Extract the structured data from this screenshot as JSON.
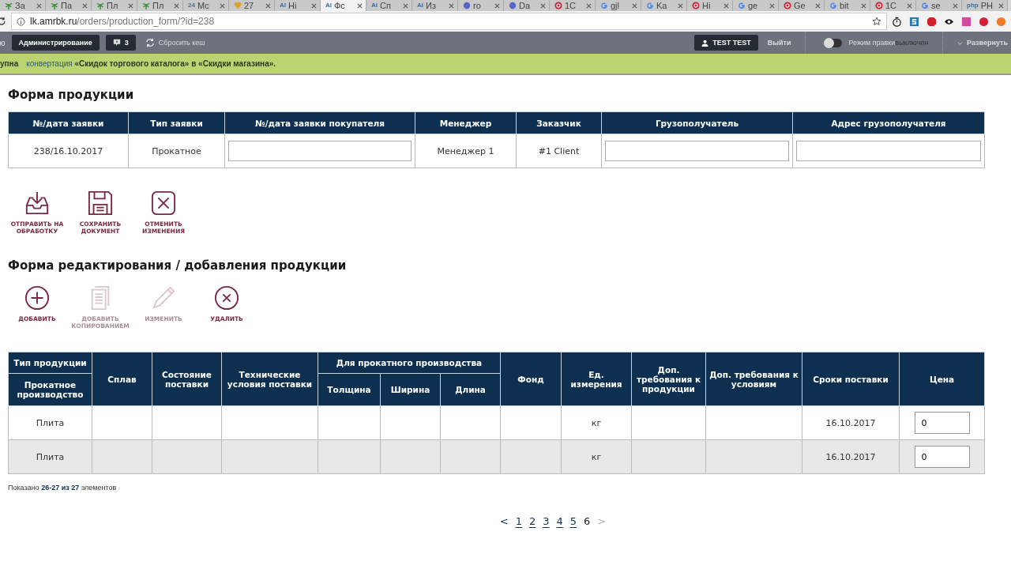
{
  "browser": {
    "tabs": [
      {
        "title": "За",
        "kind": "palm",
        "selected": false
      },
      {
        "title": "Па",
        "kind": "palm",
        "selected": false
      },
      {
        "title": "Пл",
        "kind": "palm",
        "selected": false
      },
      {
        "title": "Пл",
        "kind": "palm",
        "selected": false
      },
      {
        "title": "Мс",
        "kind": "text",
        "badge": "24",
        "selected": false
      },
      {
        "title": "27",
        "kind": "mail",
        "selected": false
      },
      {
        "title": "Hi",
        "kind": "text",
        "badge": "AI",
        "selected": false
      },
      {
        "title": "Фс",
        "kind": "text",
        "badge": "AI",
        "selected": true
      },
      {
        "title": "Сп",
        "kind": "text",
        "badge": "AI",
        "selected": false
      },
      {
        "title": "Из",
        "kind": "text",
        "badge": "AI",
        "selected": false
      },
      {
        "title": "го",
        "kind": "globe",
        "selected": false
      },
      {
        "title": "Da",
        "kind": "globe",
        "selected": false
      },
      {
        "title": "1С",
        "kind": "red",
        "selected": false
      },
      {
        "title": "gjl",
        "kind": "g",
        "selected": false
      },
      {
        "title": "Ka",
        "kind": "g",
        "selected": false
      },
      {
        "title": "Hi",
        "kind": "red",
        "selected": false
      },
      {
        "title": "ge",
        "kind": "g",
        "selected": false
      },
      {
        "title": "Ge",
        "kind": "red",
        "selected": false
      },
      {
        "title": "bit",
        "kind": "g",
        "selected": false
      },
      {
        "title": "1С",
        "kind": "red",
        "selected": false
      },
      {
        "title": "se",
        "kind": "g",
        "selected": false
      },
      {
        "title": "PH",
        "kind": "text",
        "badge": "php",
        "selected": false
      }
    ],
    "url_host": "lk.amrbk.ru",
    "url_path": "/orders/production_form/?id=238"
  },
  "admin_bar": {
    "left_cut": "ю",
    "admin": "Администрирование",
    "messages": "3",
    "reset": "Сбросить кеш",
    "user": "TEST TEST",
    "logout": "Выйти",
    "edit_mode": {
      "label": "Режим правки",
      "state": "выключен",
      "on": false
    },
    "expand": "Развернуть"
  },
  "notice": {
    "lead": "упна",
    "link": "конвертация",
    "text": "«Скидок торгового каталога» в «Скидки магазина»."
  },
  "order_form": {
    "title": "Форма продукции",
    "columns": [
      "№/дата заявки",
      "Тип заявки",
      "№/дата заявки покупателя",
      "Менеджер",
      "Заказчик",
      "Грузополучатель",
      "Адрес грузополучателя"
    ],
    "cells": [
      {
        "kind": "text",
        "value": "238/16.10.2017"
      },
      {
        "kind": "text",
        "value": "Прокатное"
      },
      {
        "kind": "input"
      },
      {
        "kind": "text",
        "value": "Менеджер 1"
      },
      {
        "kind": "text",
        "value": "#1 Client"
      },
      {
        "kind": "input"
      },
      {
        "kind": "input"
      }
    ]
  },
  "doc_actions": [
    {
      "kind": "inbox",
      "label": "ОТПРАВИТЬ НА ОБРАБОТКУ",
      "disabled": false
    },
    {
      "kind": "save",
      "label": "СОХРАНИТЬ ДОКУМЕНТ",
      "disabled": false
    },
    {
      "kind": "cancel",
      "label": "ОТМЕНИТЬ ИЗМЕНЕНИЯ",
      "disabled": false
    }
  ],
  "edit_form": {
    "title": "Форма редактирования / добавления продукции",
    "actions": [
      {
        "kind": "add",
        "label": "ДОБАВИТЬ",
        "disabled": false
      },
      {
        "kind": "copy",
        "label": "ДОБАВИТЬ КОПИРОВАНИЕМ",
        "disabled": true
      },
      {
        "kind": "edit",
        "label": "ИЗМЕНИТЬ",
        "disabled": true
      },
      {
        "kind": "delete",
        "label": "УДАЛИТЬ",
        "disabled": false
      }
    ],
    "header": {
      "type_group": "Тип продукции",
      "type_sub": "Прокатное производство",
      "splav": "Сплав",
      "state": "Состояние поставки",
      "tech": "Технические условия поставки",
      "rolled_group": "Для прокатного производства",
      "rolled_cols": [
        "Толщина",
        "Ширина",
        "Длина"
      ],
      "after": [
        "Фонд",
        "Ед. измерения",
        "Доп. требования к продукции",
        "Доп. требования к условиям",
        "Сроки поставки",
        "Цена"
      ]
    },
    "rows": [
      {
        "type": "Плита",
        "unit": "кг",
        "date": "16.10.2017",
        "price": "0",
        "highlighted": false
      },
      {
        "type": "Плита",
        "unit": "кг",
        "date": "16.10.2017",
        "price": "0",
        "highlighted": true
      }
    ],
    "summary": {
      "prefix": "Показано",
      "range": "26-27 из 27",
      "suffix": "элементов"
    },
    "pagination": {
      "prev": "<",
      "next": ">",
      "next_disabled": true,
      "pages": [
        {
          "label": "1",
          "selected": false
        },
        {
          "label": "2",
          "selected": false
        },
        {
          "label": "3",
          "selected": false
        },
        {
          "label": "4",
          "selected": false
        },
        {
          "label": "5",
          "selected": false
        },
        {
          "label": "6",
          "selected": true
        }
      ]
    }
  }
}
